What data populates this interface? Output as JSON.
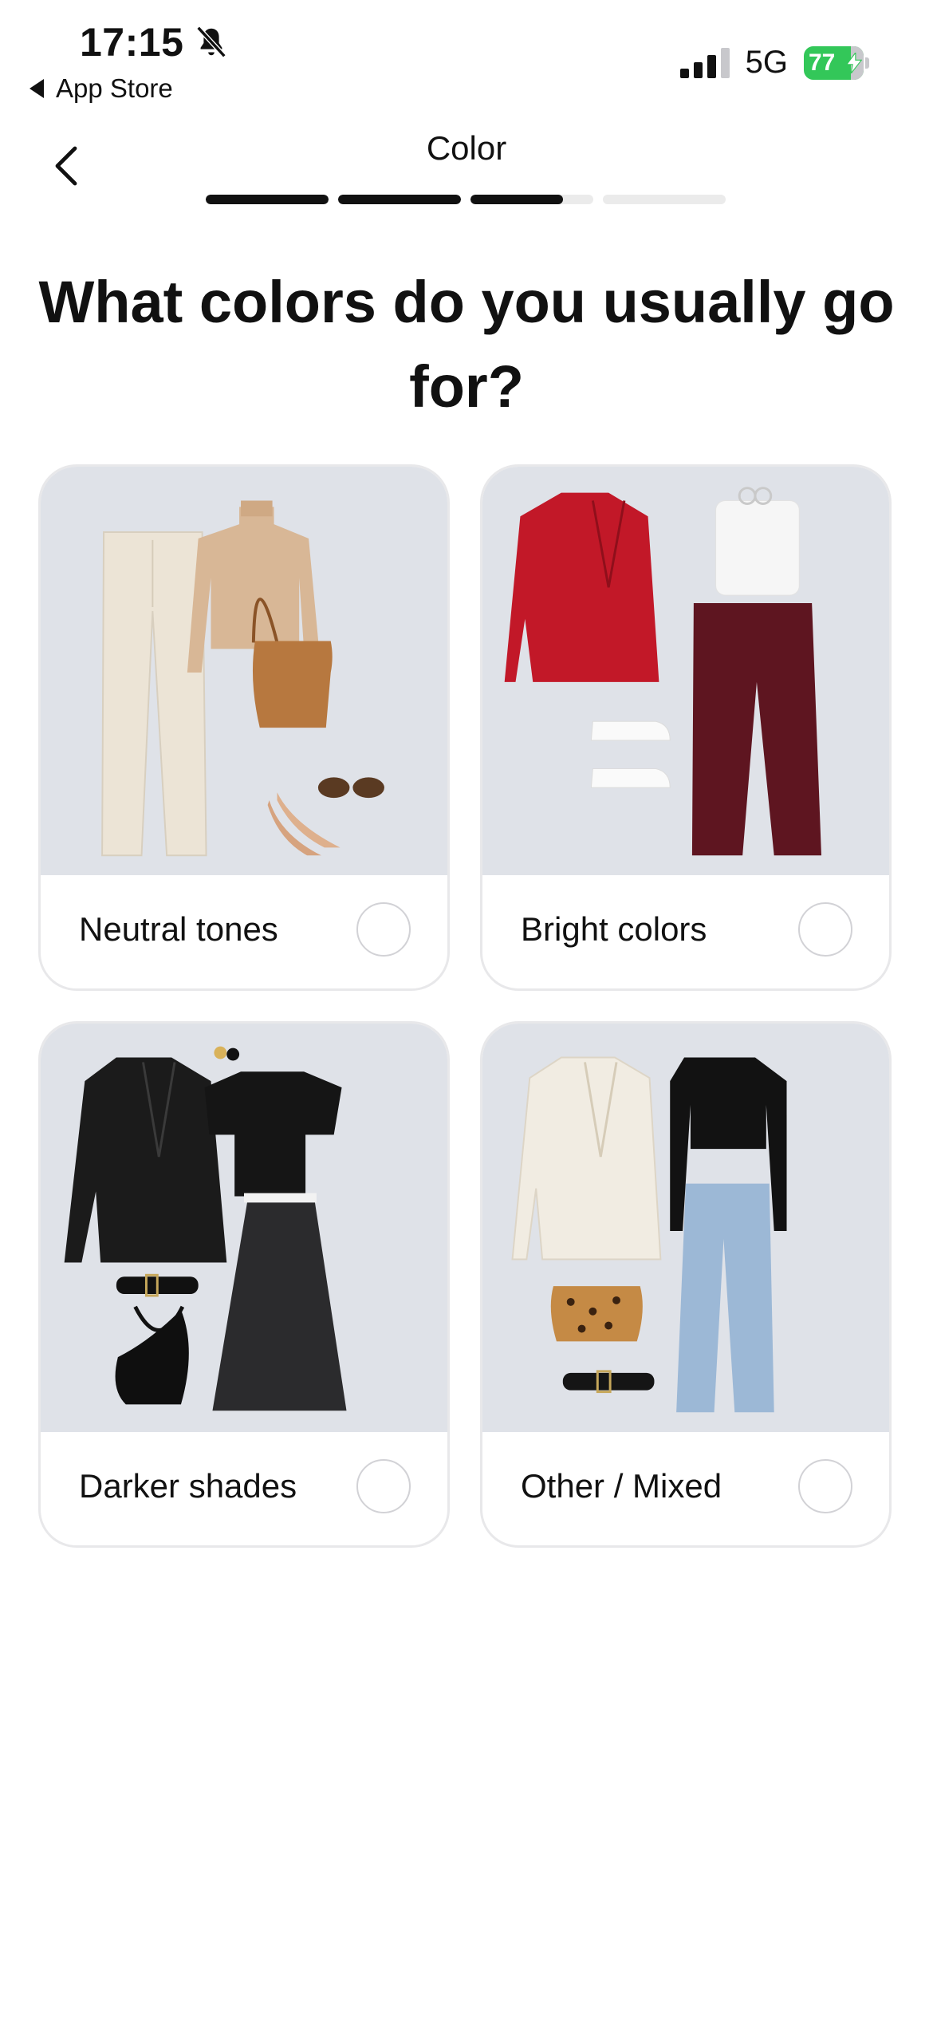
{
  "status_bar": {
    "time": "17:15",
    "back_app": "App Store",
    "network": "5G",
    "battery_level": "77",
    "battery_fraction": 0.77,
    "signal_bars_active": 3,
    "icons": [
      "bell-slash-icon",
      "signal-icon",
      "battery-icon",
      "charging-bolt-icon"
    ]
  },
  "header": {
    "title": "Color",
    "back_icon": "chevron-left-icon",
    "progress": [
      1,
      1,
      0.75,
      0
    ]
  },
  "question": "What colors do you usually go for?",
  "options": [
    {
      "label": "Neutral tones",
      "selected": false
    },
    {
      "label": "Bright colors",
      "selected": false
    },
    {
      "label": "Darker shades",
      "selected": false
    },
    {
      "label": "Other / Mixed",
      "selected": false
    }
  ],
  "colors": {
    "accent": "#111111",
    "card_image_bg": "#dfe2e8",
    "card_border": "#e8e8ea",
    "battery_green": "#33c759",
    "progress_track": "#ebebeb"
  }
}
